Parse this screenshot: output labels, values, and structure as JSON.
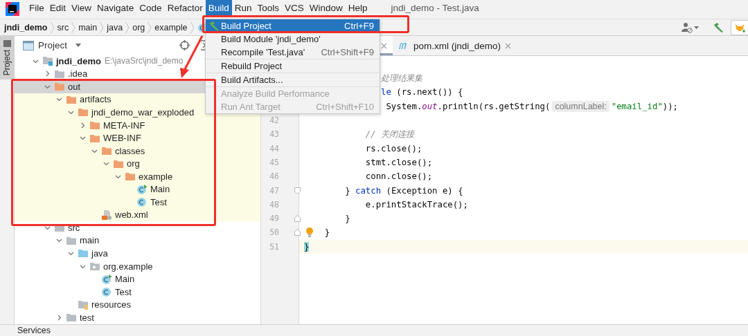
{
  "menubar": {
    "items": [
      {
        "label": "File",
        "selected": false
      },
      {
        "label": "Edit",
        "selected": false
      },
      {
        "label": "View",
        "selected": false
      },
      {
        "label": "Navigate",
        "selected": false
      },
      {
        "label": "Code",
        "selected": false
      },
      {
        "label": "Refactor",
        "selected": false
      },
      {
        "label": "Build",
        "selected": true
      },
      {
        "label": "Run",
        "selected": false
      },
      {
        "label": "Tools",
        "selected": false
      },
      {
        "label": "VCS",
        "selected": false
      },
      {
        "label": "Window",
        "selected": false
      },
      {
        "label": "Help",
        "selected": false
      }
    ],
    "title": "jndi_demo - Test.java"
  },
  "breadcrumbs": [
    {
      "label": "jndi_demo",
      "kind": "module"
    },
    {
      "label": "src",
      "kind": "folder"
    },
    {
      "label": "main",
      "kind": "folder"
    },
    {
      "label": "java",
      "kind": "folder"
    },
    {
      "label": "org",
      "kind": "folder"
    },
    {
      "label": "example",
      "kind": "folder"
    },
    {
      "kind": "class"
    }
  ],
  "side_stripe": {
    "label": "Project",
    "selected": true
  },
  "project": {
    "title": "Project",
    "tree": [
      {
        "label": "jndi_demo",
        "path": "E:\\javaSrc\\jndi_demo",
        "kind": "module",
        "expanded": true,
        "selected": false,
        "excluded": false,
        "children": [
          {
            "label": ".idea",
            "kind": "folder",
            "expanded": false,
            "selected": false,
            "excluded": false
          },
          {
            "label": "out",
            "kind": "folder",
            "expanded": true,
            "selected": true,
            "excluded": true,
            "children": [
              {
                "label": "artifacts",
                "kind": "folder",
                "expanded": true,
                "selected": false,
                "excluded": true,
                "children": [
                  {
                    "label": "jndi_demo_war_exploded",
                    "kind": "folder",
                    "expanded": true,
                    "selected": false,
                    "excluded": true,
                    "children": [
                      {
                        "label": "META-INF",
                        "kind": "folder",
                        "expanded": false,
                        "selected": false,
                        "excluded": true
                      },
                      {
                        "label": "WEB-INF",
                        "kind": "folder",
                        "expanded": true,
                        "selected": false,
                        "excluded": true,
                        "children": [
                          {
                            "label": "classes",
                            "kind": "folder",
                            "expanded": true,
                            "selected": false,
                            "excluded": true,
                            "children": [
                              {
                                "label": "org",
                                "kind": "folder",
                                "expanded": true,
                                "selected": false,
                                "excluded": true,
                                "children": [
                                  {
                                    "label": "example",
                                    "kind": "folder",
                                    "expanded": true,
                                    "selected": false,
                                    "excluded": true,
                                    "children": [
                                      {
                                        "label": "Main",
                                        "kind": "class-main",
                                        "selected": false,
                                        "excluded": true
                                      },
                                      {
                                        "label": "Test",
                                        "kind": "class",
                                        "selected": false,
                                        "excluded": true
                                      }
                                    ]
                                  }
                                ]
                              }
                            ]
                          },
                          {
                            "label": "web.xml",
                            "kind": "xml",
                            "selected": false,
                            "excluded": true
                          }
                        ]
                      }
                    ]
                  }
                ]
              }
            ]
          },
          {
            "label": "src",
            "kind": "folder",
            "expanded": true,
            "selected": false,
            "excluded": false,
            "children": [
              {
                "label": "main",
                "kind": "folder",
                "expanded": true,
                "selected": false,
                "excluded": false,
                "children": [
                  {
                    "label": "java",
                    "kind": "source-root",
                    "expanded": true,
                    "selected": false,
                    "excluded": false,
                    "children": [
                      {
                        "label": "org.example",
                        "kind": "package",
                        "expanded": true,
                        "selected": false,
                        "excluded": false,
                        "children": [
                          {
                            "label": "Main",
                            "kind": "class-main",
                            "selected": false,
                            "excluded": false
                          },
                          {
                            "label": "Test",
                            "kind": "class",
                            "selected": false,
                            "excluded": false
                          }
                        ]
                      }
                    ]
                  },
                  {
                    "label": "resources",
                    "kind": "resources",
                    "selected": false,
                    "excluded": false
                  }
                ]
              },
              {
                "label": "test",
                "kind": "folder",
                "expanded": false,
                "selected": false,
                "excluded": false
              }
            ]
          }
        ]
      }
    ]
  },
  "editor_tabs": [
    {
      "selected": true
    },
    {
      "label": "pom.xml (jndi_demo)",
      "selected": false
    }
  ],
  "code": [
    {
      "tokens": [
        {
          "kind": "comment",
          "text": "               处理结果集"
        }
      ]
    },
    {
      "tokens": [
        {
          "kind": "keyword",
          "text": "               le"
        },
        {
          "kind": "plain",
          "text": " (rs.next()) {"
        }
      ]
    },
    {
      "tokens": [
        {
          "kind": "plain",
          "text": "                System."
        },
        {
          "kind": "static",
          "text": "out"
        },
        {
          "kind": "plain",
          "text": ".println(rs.getString("
        },
        {
          "kind": "hint",
          "text": "columnLabel:"
        },
        {
          "kind": "string",
          "text": "\"email_id\""
        },
        {
          "kind": "plain",
          "text": "));"
        }
      ]
    },
    {
      "number": "42",
      "current": false
    },
    {
      "number": "43",
      "current": false,
      "tokens": [
        {
          "kind": "comment",
          "text": "            // 关闭连接"
        }
      ]
    },
    {
      "number": "44",
      "current": false,
      "tokens": [
        {
          "kind": "plain",
          "text": "            rs.close();"
        }
      ]
    },
    {
      "number": "45",
      "current": false,
      "tokens": [
        {
          "kind": "plain",
          "text": "            stmt.close();"
        }
      ]
    },
    {
      "number": "46",
      "current": false,
      "tokens": [
        {
          "kind": "plain",
          "text": "            conn.close();"
        }
      ]
    },
    {
      "number": "47",
      "current": false,
      "kind": "fold-open",
      "tokens": [
        {
          "kind": "plain",
          "text": "        } "
        },
        {
          "kind": "keyword",
          "text": "catch"
        },
        {
          "kind": "plain",
          "text": " (Exception e) {"
        }
      ]
    },
    {
      "number": "48",
      "current": false,
      "tokens": [
        {
          "kind": "plain",
          "text": "            e.printStackTrace();"
        }
      ]
    },
    {
      "number": "49",
      "current": false,
      "kind": "fold-close",
      "tokens": [
        {
          "kind": "plain",
          "text": "        }"
        }
      ]
    },
    {
      "number": "50",
      "current": false,
      "kind": "fold-close",
      "bulb": true,
      "tokens": [
        {
          "kind": "plain",
          "text": "    }"
        }
      ]
    },
    {
      "number": "51",
      "current": true,
      "tokens": [
        {
          "kind": "brace-match",
          "text": "}"
        }
      ]
    }
  ],
  "build_menu": {
    "groups": [
      [
        {
          "label": "Build Project",
          "shortcut": "Ctrl+F9",
          "icon": true,
          "selected": true,
          "disabled": false
        },
        {
          "label": "Build Module 'jndi_demo'",
          "selected": false,
          "disabled": false
        },
        {
          "label": "Recompile 'Test.java'",
          "shortcut": "Ctrl+Shift+F9",
          "selected": false,
          "disabled": false
        }
      ],
      [
        {
          "label": "Rebuild Project",
          "selected": false,
          "disabled": false
        }
      ],
      [
        {
          "label": "Build Artifacts...",
          "selected": false,
          "disabled": false
        }
      ],
      [
        {
          "label": "Analyze Build Performance",
          "selected": false,
          "disabled": true
        },
        {
          "label": "Run Ant Target",
          "shortcut": "Ctrl+Shift+F10",
          "selected": false,
          "disabled": true
        }
      ]
    ]
  },
  "status_bar": {
    "label": "Services"
  }
}
